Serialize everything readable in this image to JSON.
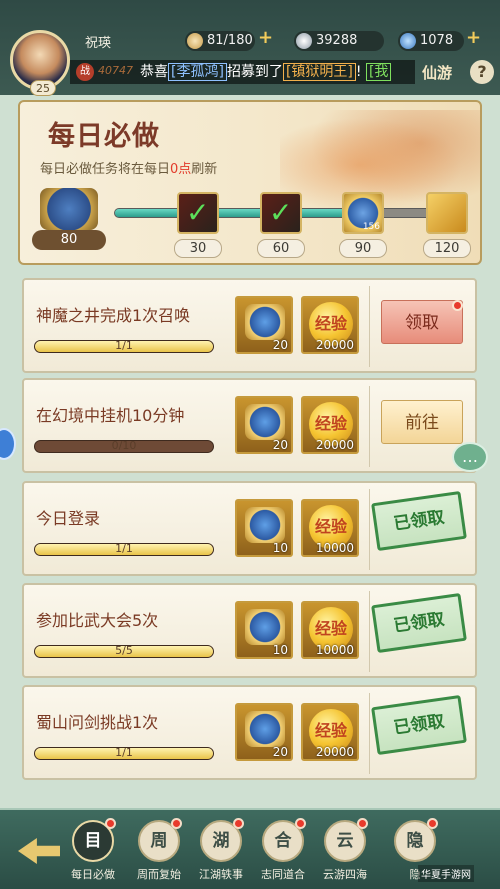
{
  "header": {
    "player_name": "祝瑛",
    "level": "25",
    "stamina": "81/180",
    "silver": "39288",
    "ingot": "1078",
    "marquee_badge": "战",
    "marquee_number": "40747",
    "marquee_text": "恭喜",
    "marquee_player": "[李孤鸿]",
    "marquee_mid": "招募到了",
    "marquee_item": "[镇狱明王]",
    "marquee_end": "!",
    "marquee_next": "[我",
    "area_label": "仙游",
    "help_label": "?"
  },
  "panel": {
    "title": "每日必做",
    "subtitle_pre": "每日必做任务将在每日",
    "subtitle_highlight": "0点",
    "subtitle_post": "刷新",
    "current_points": "80",
    "progress_fraction": 0.68,
    "milestones": [
      {
        "points": "30",
        "state": "claimed",
        "label": ""
      },
      {
        "points": "60",
        "state": "claimed",
        "label": ""
      },
      {
        "points": "90",
        "state": "locked",
        "label": "156"
      },
      {
        "points": "120",
        "state": "locked",
        "label": ""
      }
    ]
  },
  "tasks": [
    {
      "name": "神魔之井完成1次召唤",
      "progress_text": "1/1",
      "progress": 1.0,
      "reward1": "20",
      "reward2": "20000",
      "reward2_label": "经验",
      "button": "领取",
      "state": "claim"
    },
    {
      "name": "在幻境中挂机10分钟",
      "progress_text": "0/10",
      "progress": 0.0,
      "reward1": "20",
      "reward2": "20000",
      "reward2_label": "经验",
      "button": "前往",
      "state": "go"
    },
    {
      "name": "今日登录",
      "progress_text": "1/1",
      "progress": 1.0,
      "reward1": "10",
      "reward2": "10000",
      "reward2_label": "经验",
      "button": "已领取",
      "state": "done"
    },
    {
      "name": "参加比武大会5次",
      "progress_text": "5/5",
      "progress": 1.0,
      "reward1": "10",
      "reward2": "10000",
      "reward2_label": "经验",
      "button": "已领取",
      "state": "done"
    },
    {
      "name": "蜀山问剑挑战1次",
      "progress_text": "1/1",
      "progress": 1.0,
      "reward1": "20",
      "reward2": "20000",
      "reward2_label": "经验",
      "button": "已领取",
      "state": "done"
    }
  ],
  "bottom_nav": [
    {
      "label": "每日必做",
      "glyph": "目",
      "active": true
    },
    {
      "label": "周而复始",
      "glyph": "周",
      "active": false
    },
    {
      "label": "江湖轶事",
      "glyph": "湖",
      "active": false
    },
    {
      "label": "志同道合",
      "glyph": "合",
      "active": false
    },
    {
      "label": "云游四海",
      "glyph": "云",
      "active": false
    },
    {
      "label": "隐",
      "glyph": "隐",
      "active": false
    }
  ],
  "watermark": "华夏手游网",
  "chat_icon_glyph": "…"
}
